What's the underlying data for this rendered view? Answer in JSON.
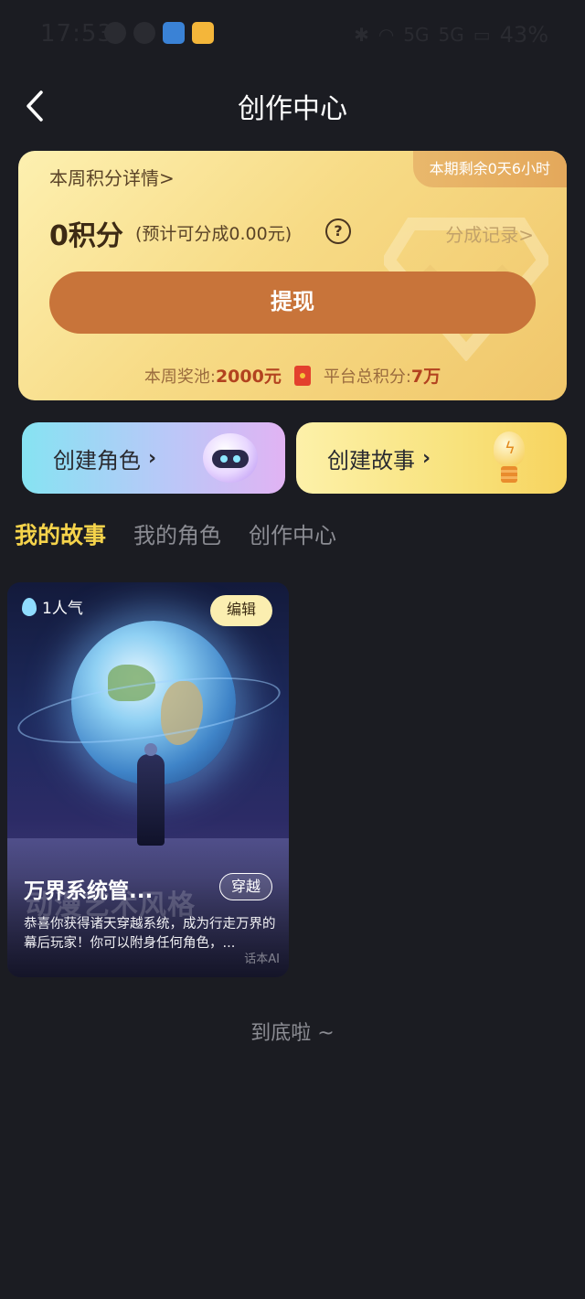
{
  "status_bar": {
    "time": "17:53",
    "battery": "43%",
    "signal_1": "5G",
    "signal_2": "5G"
  },
  "header": {
    "title": "创作中心",
    "back_icon": "chevron-left-icon"
  },
  "points_card": {
    "remaining": "本期剩余0天6小时",
    "week_details": "本周积分详情>",
    "points": "0积分",
    "estimate": "(预计可分成0.00元)",
    "help_icon": "?",
    "share_record": "分成记录>",
    "withdraw_label": "提现",
    "pool_label": "本周奖池:",
    "pool_value": "2000元",
    "platform_label": "平台总积分:",
    "platform_value": "7万"
  },
  "create": {
    "role_label": "创建角色",
    "story_label": "创建故事",
    "chevron": "›"
  },
  "tabs": [
    {
      "label": "我的故事",
      "active": true
    },
    {
      "label": "我的角色",
      "active": false
    },
    {
      "label": "创作中心",
      "active": false
    }
  ],
  "story": {
    "popularity": "1人气",
    "edit_label": "编辑",
    "title": "万界系统管...",
    "genre": "穿越",
    "watermark": "动漫艺术风格",
    "description": "恭喜你获得诸天穿越系统，成为行走万界的幕后玩家！你可以附身任何角色，...",
    "brand": "话本AI"
  },
  "footer": {
    "end_text": "到底啦 ~"
  },
  "colors": {
    "background": "#1b1c22",
    "accent_yellow": "#f5d34b",
    "withdraw_button": "#c8743a"
  }
}
